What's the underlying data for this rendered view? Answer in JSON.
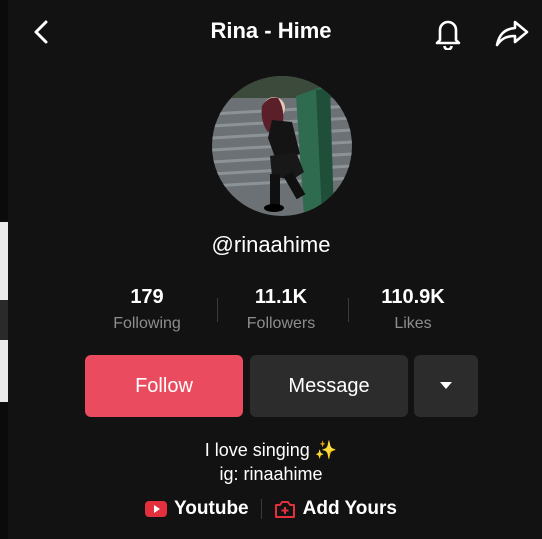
{
  "header": {
    "title": "Rina - Hime"
  },
  "profile": {
    "handle": "@rinaahime"
  },
  "stats": [
    {
      "value": "179",
      "label": "Following"
    },
    {
      "value": "11.1K",
      "label": "Followers"
    },
    {
      "value": "110.9K",
      "label": "Likes"
    }
  ],
  "actions": {
    "follow": "Follow",
    "message": "Message"
  },
  "bio": {
    "line1": "I love singing ✨",
    "line2": "ig: rinaahime"
  },
  "links": {
    "youtube": "Youtube",
    "add_yours": "Add Yours"
  },
  "colors": {
    "follow": "#ea4b5e",
    "youtube": "#e4303c",
    "addyours": "#e4303c",
    "muted": "#8d8d8d"
  },
  "icons": [
    "chevron-left-icon",
    "bell-icon",
    "share-icon",
    "caret-down-icon",
    "youtube-icon",
    "add-yours-icon"
  ]
}
